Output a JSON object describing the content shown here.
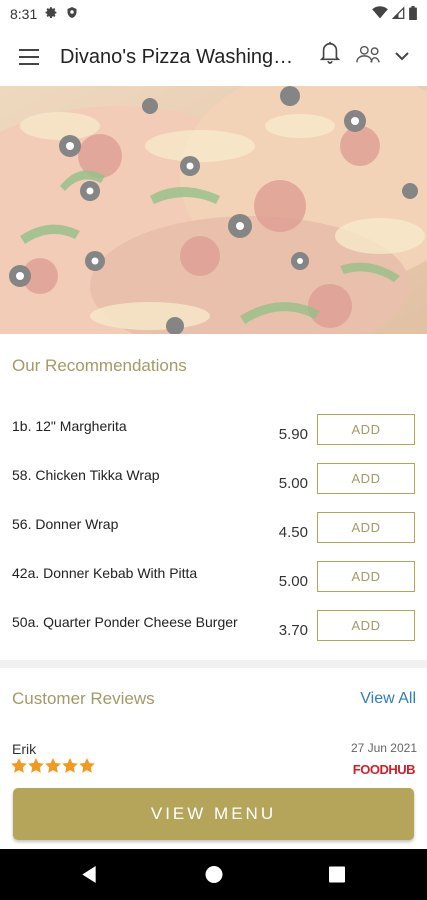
{
  "status_bar": {
    "time": "8:31",
    "icons": [
      "gear-icon",
      "shield-icon",
      "wifi-icon",
      "signal-icon",
      "battery-icon"
    ]
  },
  "app_bar": {
    "title": "Divano's Pizza Washington",
    "icons": [
      "menu-icon",
      "bell-icon",
      "account-icon",
      "chevron-down-icon"
    ]
  },
  "recommendations": {
    "title": "Our Recommendations",
    "items": [
      {
        "name": "1b. 12\" Margherita",
        "price": "5.90",
        "button": "ADD"
      },
      {
        "name": "58. Chicken Tikka Wrap",
        "price": "5.00",
        "button": "ADD"
      },
      {
        "name": "56. Donner Wrap",
        "price": "4.50",
        "button": "ADD"
      },
      {
        "name": "42a. Donner Kebab With Pitta",
        "price": "5.00",
        "button": "ADD"
      },
      {
        "name": "50a. Quarter Ponder Cheese Burger",
        "price": "3.70",
        "button": "ADD"
      }
    ]
  },
  "reviews": {
    "title": "Customer Reviews",
    "view_all": "View All",
    "items": [
      {
        "name": "Erik",
        "date": "27 Jun 2021",
        "rating": 5,
        "source": "FOODHUB"
      }
    ]
  },
  "view_menu_button": "VIEW MENU",
  "colors": {
    "accent": "#b5a55a",
    "link": "#2f7fb8",
    "star": "#f39a1e",
    "foodhub": "#d0202a"
  }
}
